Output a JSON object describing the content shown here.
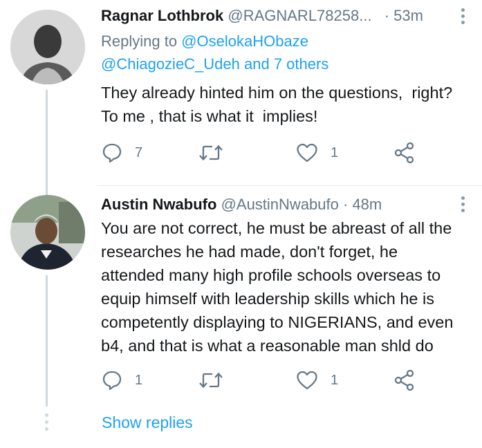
{
  "tweets": [
    {
      "name": "Ragnar Lothbrok",
      "handle": "@RAGNARL78258...",
      "time": "· 53m",
      "replying_prefix": "Replying to",
      "replying_first": "@OselokaHObaze",
      "replying_rest": "@ChiagozieC_Udeh and 7 others",
      "text": "They already hinted him on the questions,  right?\nTo me , that is what it  implies!",
      "replies": "7",
      "retweets": "",
      "likes": "1",
      "icons": {
        "reply": "reply-icon",
        "retweet": "retweet-icon",
        "like": "heart-icon",
        "share": "share-icon"
      }
    },
    {
      "name": "Austin Nwabufo",
      "handle": "@AustinNwabufo",
      "time": "· 48m",
      "text": "You are not correct, he must be abreast of all the\nresearches he had made, don't forget, he\nattended many high profile schools overseas to\nequip himself with leadership skills which he is\ncompetently displaying to NIGERIANS, and even\nb4, and that is what a reasonable man shld do",
      "replies": "1",
      "retweets": "",
      "likes": "1",
      "icons": {
        "reply": "reply-icon",
        "retweet": "retweet-icon",
        "like": "heart-icon",
        "share": "share-icon"
      }
    }
  ],
  "show_replies": "Show replies",
  "colors": {
    "link": "#1da1f2",
    "muted": "#657786",
    "thread": "#cfd9de"
  }
}
